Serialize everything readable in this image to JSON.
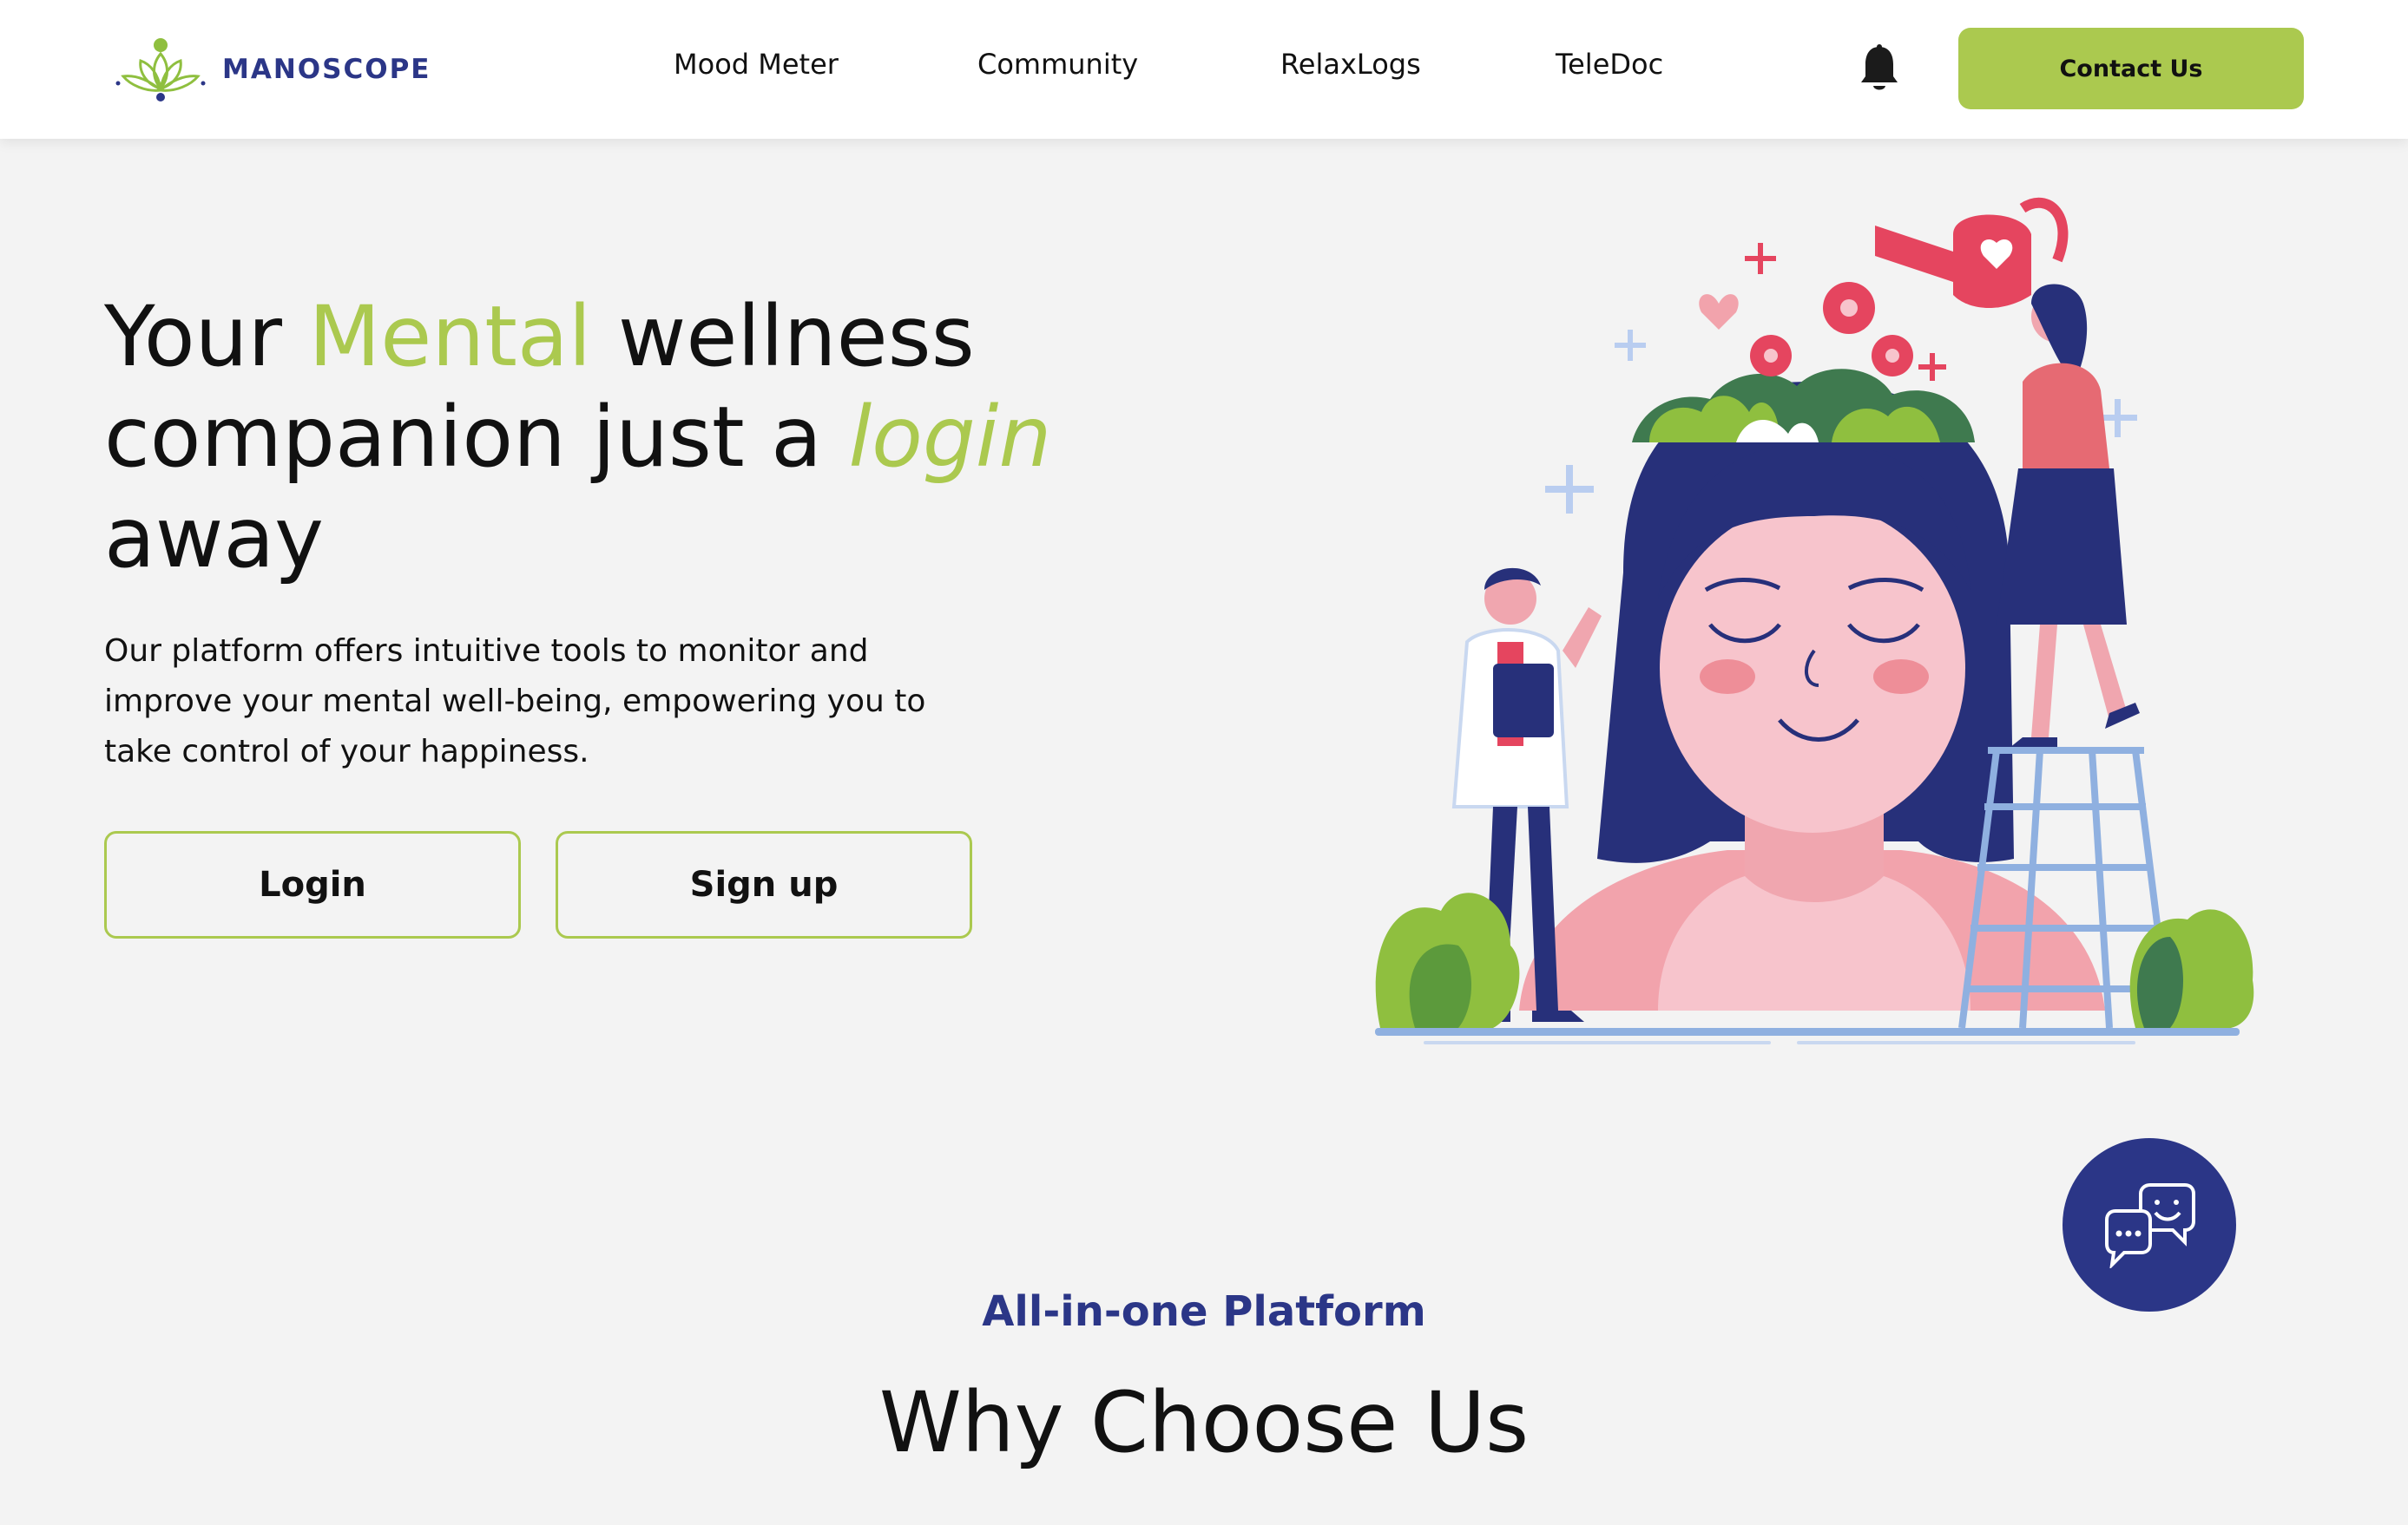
{
  "header": {
    "brand": "MANOSCOPE",
    "nav": [
      {
        "label": "Mood Meter"
      },
      {
        "label": "Community"
      },
      {
        "label": "RelaxLogs"
      },
      {
        "label": "TeleDoc"
      }
    ],
    "notification_icon": "bell-icon",
    "contact_label": "Contact Us"
  },
  "hero": {
    "title_part1": "Your ",
    "title_accent": "Mental",
    "title_part2": " wellness companion just a ",
    "title_italic": "login",
    "title_part3": " away",
    "description": "Our platform offers intuitive tools to monitor and improve your mental well-being, empowering you to take control of your happiness.",
    "login_label": "Login",
    "signup_label": "Sign up"
  },
  "chat": {
    "icon": "chat-bubbles-icon"
  },
  "section": {
    "kicker": "All-in-one Platform",
    "title": "Why Choose Us"
  },
  "colors": {
    "accent": "#abc94f",
    "brand": "#2b3687",
    "background": "#f3f3f3"
  }
}
